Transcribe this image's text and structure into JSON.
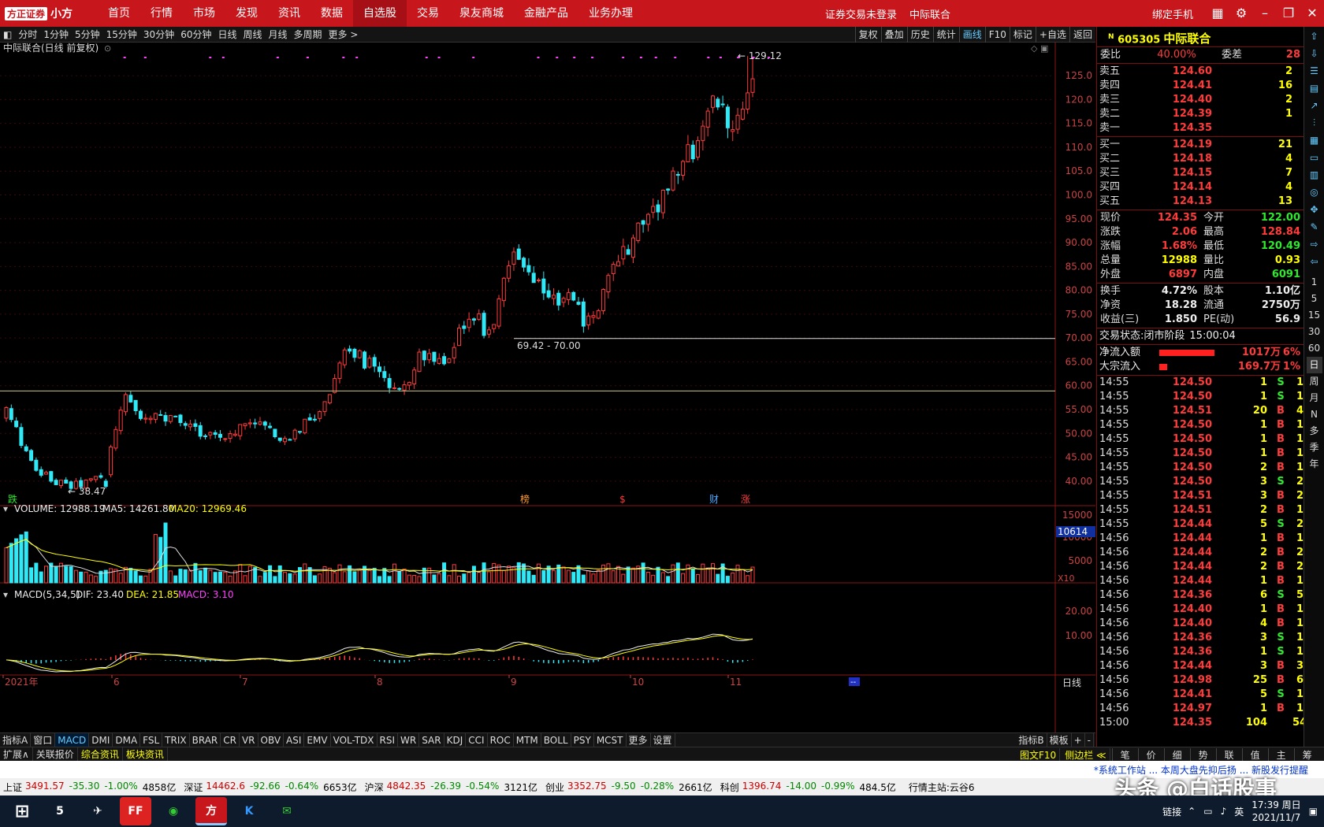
{
  "app": {
    "logo_mark": "方正证券",
    "logo_name": "小方",
    "menu": [
      "首页",
      "行情",
      "市场",
      "发现",
      "资讯",
      "数据",
      "自选股",
      "交易",
      "泉友商城",
      "金融产品",
      "业务办理"
    ],
    "active_menu": "自选股",
    "status_text": "证券交易未登录",
    "stock_title": "中际联合",
    "bind_phone": "绑定手机"
  },
  "chart_toolbar": {
    "periods": [
      "分时",
      "1分钟",
      "5分钟",
      "15分钟",
      "30分钟",
      "60分钟",
      "日线",
      "周线",
      "月线",
      "多周期",
      "更多 >"
    ],
    "right_items": [
      "复权",
      "叠加",
      "历史",
      "统计",
      "画线",
      "F10",
      "标记",
      "+自选",
      "返回"
    ]
  },
  "chart": {
    "title": "中际联合(日线 前复权)",
    "high_label": "129.12",
    "low_label": "38.47",
    "range_label": "69.42 - 70.00",
    "price_ticks": [
      "125.0",
      "120.0",
      "115.0",
      "110.0",
      "105.0",
      "100.0",
      "95.00",
      "90.00",
      "85.00",
      "80.00",
      "75.00",
      "70.00",
      "65.00",
      "60.00",
      "55.00",
      "50.00",
      "45.00",
      "40.00"
    ],
    "markers": [
      {
        "text": "跌",
        "color": "#2fe92f"
      },
      {
        "text": "榜",
        "color": "#ff9a2a"
      },
      {
        "text": "$",
        "color": "#ff3b3b"
      },
      {
        "text": "财",
        "color": "#4aa8ff"
      },
      {
        "text": "涨",
        "color": "#ff3b3b"
      }
    ]
  },
  "volume": {
    "label_volume": "VOLUME: 12988.19",
    "label_ma5": "MA5: 14261.80",
    "label_ma20": "MA20: 12969.46",
    "ticks": [
      "15000",
      "10000",
      "5000"
    ],
    "badge": "10614",
    "unit": "X10"
  },
  "macd": {
    "label_name": "MACD(5,34,5)",
    "label_dif": "DIF: 23.40",
    "label_dea": "DEA: 21.85",
    "label_macd": "MACD: 3.10",
    "ticks": [
      "20.00",
      "10.00"
    ]
  },
  "date_axis": {
    "labels": [
      "2021年",
      "6",
      "7",
      "8",
      "9",
      "10",
      "11"
    ],
    "period": "日线",
    "marker": "--"
  },
  "indicator_tabs": [
    "指标A",
    "窗口",
    "MACD",
    "DMI",
    "DMA",
    "FSL",
    "TRIX",
    "BRAR",
    "CR",
    "VR",
    "OBV",
    "ASI",
    "EMV",
    "VOL-TDX",
    "RSI",
    "WR",
    "SAR",
    "KDJ",
    "CCI",
    "ROC",
    "MTM",
    "BOLL",
    "PSY",
    "MCST",
    "更多",
    "设置"
  ],
  "indicator_active": "MACD",
  "indicator_right": [
    "指标B",
    "模板",
    "+",
    "-"
  ],
  "bottom_tabs": [
    "扩展∧",
    "关联报价",
    "综合资讯",
    "板块资讯"
  ],
  "bottom_right": [
    "图文F10",
    "侧边栏 ≪"
  ],
  "quote_tabs": [
    "笔",
    "价",
    "细",
    "势",
    "联",
    "值",
    "主",
    "筹"
  ],
  "quote": {
    "code": "605305",
    "name": "中际联合",
    "committee_ratio": "40.00%",
    "committee_diff": "28",
    "asks": [
      {
        "label": "卖五",
        "price": "124.60",
        "vol": "2"
      },
      {
        "label": "卖四",
        "price": "124.41",
        "vol": "16"
      },
      {
        "label": "卖三",
        "price": "124.40",
        "vol": "2"
      },
      {
        "label": "卖二",
        "price": "124.39",
        "vol": "1"
      },
      {
        "label": "卖一",
        "price": "124.35",
        "vol": ""
      }
    ],
    "bids": [
      {
        "label": "买一",
        "price": "124.19",
        "vol": "21"
      },
      {
        "label": "买二",
        "price": "124.18",
        "vol": "4"
      },
      {
        "label": "买三",
        "price": "124.15",
        "vol": "7"
      },
      {
        "label": "买四",
        "price": "124.14",
        "vol": "4"
      },
      {
        "label": "买五",
        "price": "124.13",
        "vol": "13"
      }
    ],
    "stats1": [
      [
        "现价",
        "124.35",
        "red",
        "今开",
        "122.00",
        "grn"
      ],
      [
        "涨跌",
        "2.06",
        "red",
        "最高",
        "128.84",
        "red"
      ],
      [
        "涨幅",
        "1.68%",
        "red",
        "最低",
        "120.49",
        "grn"
      ],
      [
        "总量",
        "12988",
        "yel",
        "量比",
        "0.93",
        "yel"
      ],
      [
        "外盘",
        "6897",
        "red",
        "内盘",
        "6091",
        "grn"
      ]
    ],
    "stats2": [
      [
        "换手",
        "4.72%",
        "wht",
        "股本",
        "1.10亿",
        "wht"
      ],
      [
        "净资",
        "18.28",
        "wht",
        "流通",
        "2750万",
        "wht"
      ],
      [
        "收益(三)",
        "1.850",
        "wht",
        "PE(动)",
        "56.9",
        "wht"
      ]
    ],
    "trade_status": "交易状态:",
    "trade_value": "闭市阶段",
    "trade_time": "15:00:04",
    "net_inflow": {
      "label": "净流入额",
      "value": "1017万",
      "pct": "6%"
    },
    "block_inflow": {
      "label": "大宗流入",
      "value": "169.7万",
      "pct": "1%"
    },
    "ticks": [
      [
        "14:55",
        "124.50",
        "1",
        "S",
        "1"
      ],
      [
        "14:55",
        "124.50",
        "1",
        "S",
        "1"
      ],
      [
        "14:55",
        "124.51",
        "20",
        "B",
        "4"
      ],
      [
        "14:55",
        "124.50",
        "1",
        "B",
        "1"
      ],
      [
        "14:55",
        "124.50",
        "1",
        "B",
        "1"
      ],
      [
        "14:55",
        "124.50",
        "1",
        "B",
        "1"
      ],
      [
        "14:55",
        "124.50",
        "2",
        "B",
        "1"
      ],
      [
        "14:55",
        "124.50",
        "3",
        "S",
        "2"
      ],
      [
        "14:55",
        "124.51",
        "3",
        "B",
        "2"
      ],
      [
        "14:55",
        "124.51",
        "2",
        "B",
        "1"
      ],
      [
        "14:55",
        "124.44",
        "5",
        "S",
        "2"
      ],
      [
        "14:56",
        "124.44",
        "1",
        "B",
        "1"
      ],
      [
        "14:56",
        "124.44",
        "2",
        "B",
        "2"
      ],
      [
        "14:56",
        "124.44",
        "2",
        "B",
        "2"
      ],
      [
        "14:56",
        "124.44",
        "1",
        "B",
        "1"
      ],
      [
        "14:56",
        "124.36",
        "6",
        "S",
        "5"
      ],
      [
        "14:56",
        "124.40",
        "1",
        "B",
        "1"
      ],
      [
        "14:56",
        "124.40",
        "4",
        "B",
        "1"
      ],
      [
        "14:56",
        "124.36",
        "3",
        "S",
        "1"
      ],
      [
        "14:56",
        "124.36",
        "1",
        "S",
        "1"
      ],
      [
        "14:56",
        "124.44",
        "3",
        "B",
        "3"
      ],
      [
        "14:56",
        "124.98",
        "25",
        "B",
        "6"
      ],
      [
        "14:56",
        "124.41",
        "5",
        "S",
        "1"
      ],
      [
        "14:56",
        "124.97",
        "1",
        "B",
        "1"
      ],
      [
        "15:00",
        "124.35",
        "104",
        "",
        "54"
      ]
    ]
  },
  "right_strip": {
    "periods": [
      "1",
      "5",
      "15",
      "30",
      "60",
      "日",
      "周",
      "月",
      "N",
      "多",
      "季",
      "年"
    ],
    "active": "日"
  },
  "news": {
    "text": "*系统工作站 ... 本周大盘先抑后扬 ... 新股发行提醒"
  },
  "indices": [
    [
      "上证",
      "3491.57",
      "-35.30",
      "-1.00%",
      "4858亿"
    ],
    [
      "深证",
      "14462.6",
      "-92.66",
      "-0.64%",
      "6653亿"
    ],
    [
      "沪深",
      "4842.35",
      "-26.39",
      "-0.54%",
      "3121亿"
    ],
    [
      "创业",
      "3352.75",
      "-9.50",
      "-0.28%",
      "2661亿"
    ],
    [
      "科创",
      "1396.74",
      "-14.00",
      "-0.99%",
      "484.5亿"
    ]
  ],
  "index_source": "行情主站:云谷6",
  "watermark": "头条 @白话股事",
  "taskbar": {
    "tray_link": "链接",
    "tray_lang": "英",
    "time": "17:39 周日",
    "date": "2021/11/7",
    "app_marks": [
      "5",
      "FF",
      "K"
    ]
  },
  "colors": {
    "up": "#ff3b3b",
    "down": "#2fe9f7",
    "brand": "#c8161d"
  }
}
